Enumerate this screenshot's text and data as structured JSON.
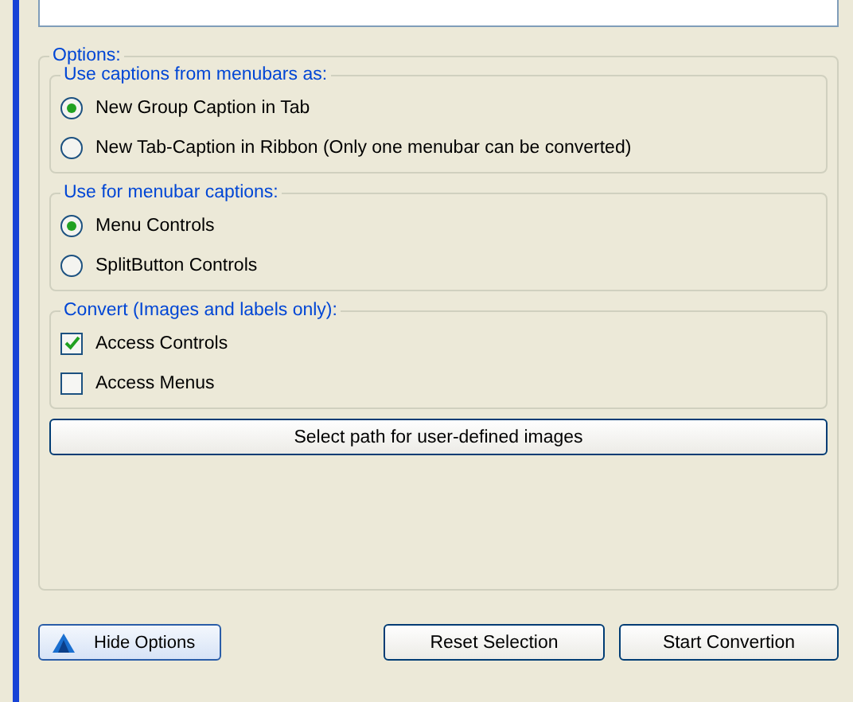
{
  "options": {
    "title": "Options:",
    "groups": [
      {
        "title": "Use captions from menubars as:",
        "items": [
          {
            "kind": "radio",
            "label": "New Group Caption in Tab",
            "selected": true
          },
          {
            "kind": "radio",
            "label": "New Tab-Caption in Ribbon (Only one menubar can be converted)",
            "selected": false
          }
        ]
      },
      {
        "title": "Use for menubar captions:",
        "items": [
          {
            "kind": "radio",
            "label": "Menu Controls",
            "selected": true
          },
          {
            "kind": "radio",
            "label": "SplitButton Controls",
            "selected": false
          }
        ]
      },
      {
        "title": "Convert (Images and labels only):",
        "items": [
          {
            "kind": "checkbox",
            "label": "Access Controls",
            "checked": true
          },
          {
            "kind": "checkbox",
            "label": "Access Menus",
            "checked": false
          }
        ]
      }
    ],
    "path_button": "Select path for user-defined images"
  },
  "buttons": {
    "hide": "Hide Options",
    "reset": "Reset Selection",
    "start": "Start Convertion"
  }
}
